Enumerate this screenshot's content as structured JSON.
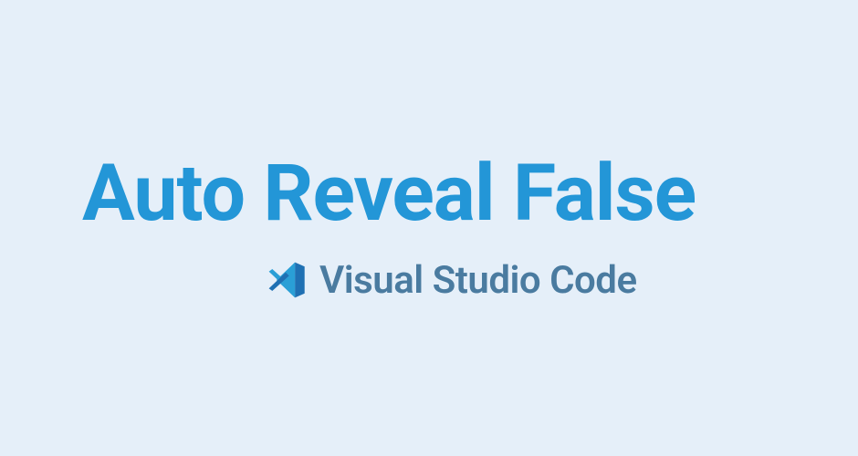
{
  "title": "Auto Reveal False",
  "subtitle": "Visual Studio Code",
  "colors": {
    "background": "#e5eff9",
    "title": "#2396d7",
    "subtitle": "#4a7ba0",
    "icon_dark": "#1f70b3",
    "icon_light": "#2a9fd6"
  }
}
